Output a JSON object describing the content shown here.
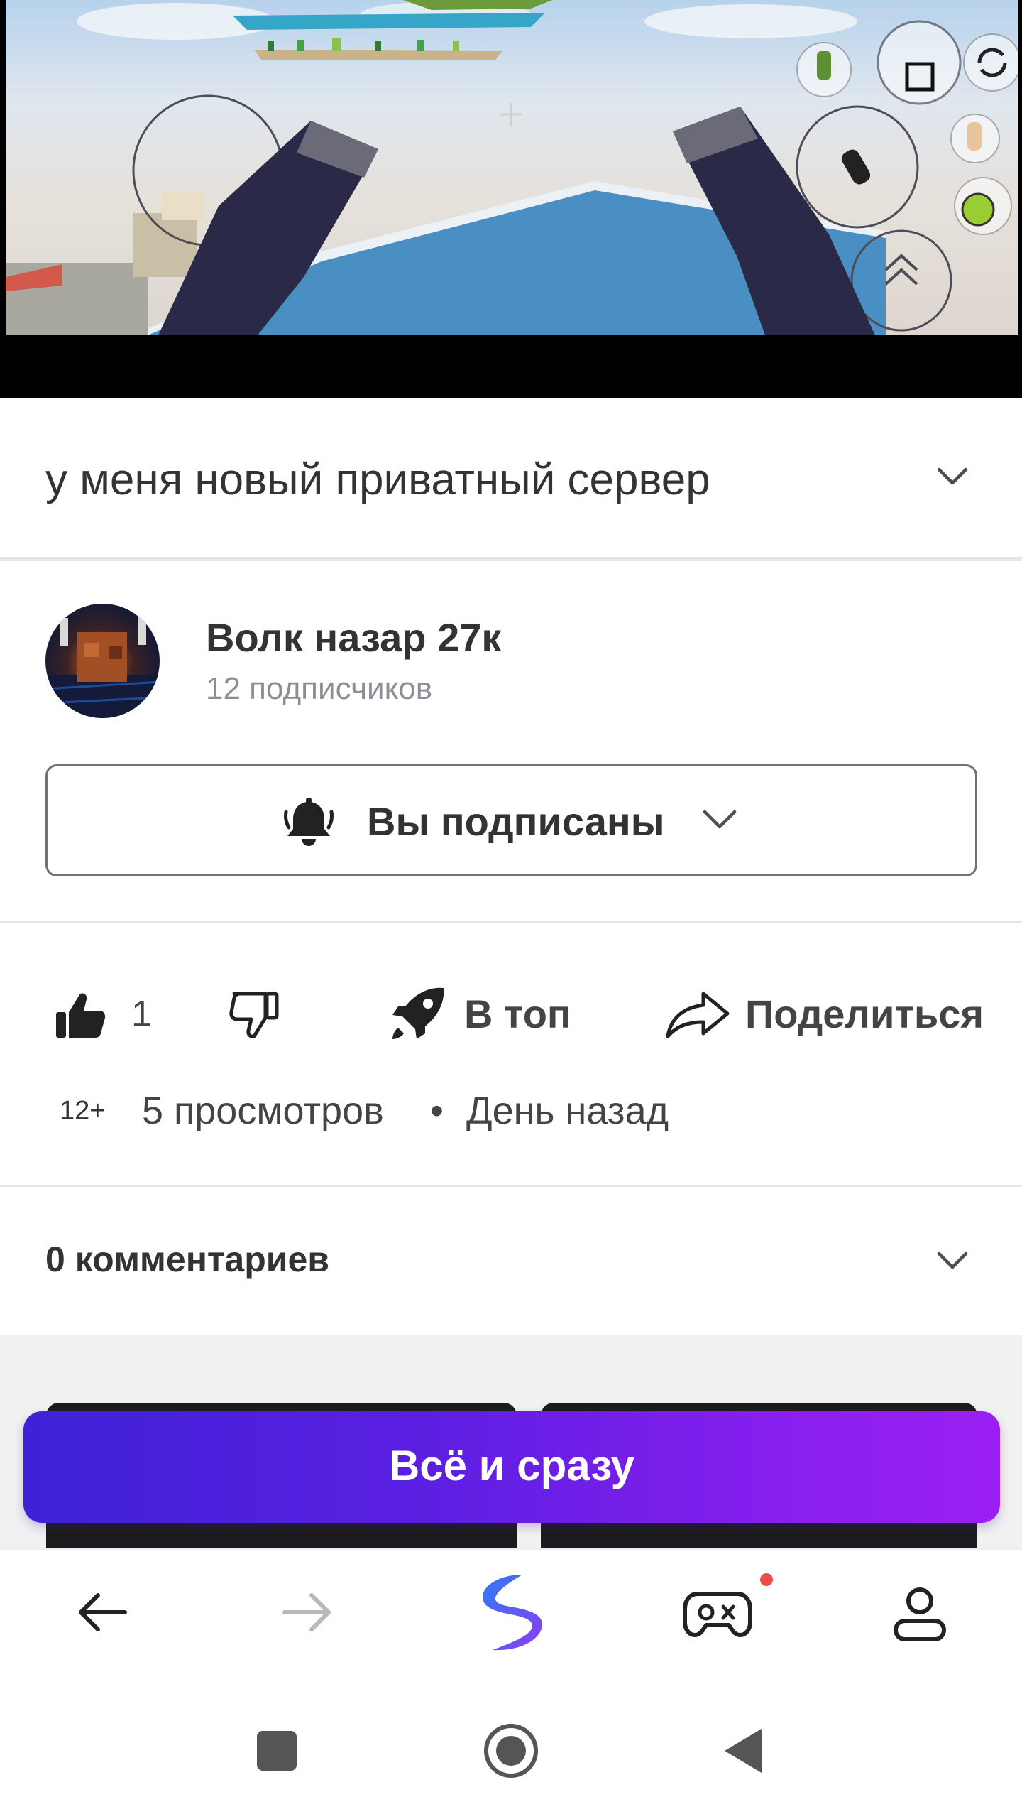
{
  "video": {
    "title": "у меня новый приватный сервер"
  },
  "channel": {
    "name": "Волк назар 27к",
    "subscribers": "12 подписчиков",
    "subscribe_state": "Вы подписаны"
  },
  "actions": {
    "likes": "1",
    "top_label": "В топ",
    "share_label": "Поделиться"
  },
  "meta": {
    "age_rating": "12+",
    "views": "5 просмотров",
    "separator": "•",
    "published": "День назад"
  },
  "comments": {
    "label": "0 комментариев"
  },
  "promo": {
    "label": "Всё и сразу"
  },
  "bottom_nav": {
    "items": [
      "back-icon",
      "forward-icon",
      "app-logo-icon",
      "gamepad-icon",
      "profile-icon"
    ],
    "games_has_notification": true
  },
  "system_nav": {
    "items": [
      "recents-square-icon",
      "home-circle-icon",
      "back-triangle-icon"
    ]
  },
  "colors": {
    "accent_start": "#3e22d8",
    "accent_end": "#9a1ff2",
    "notification": "#f04a4a"
  }
}
